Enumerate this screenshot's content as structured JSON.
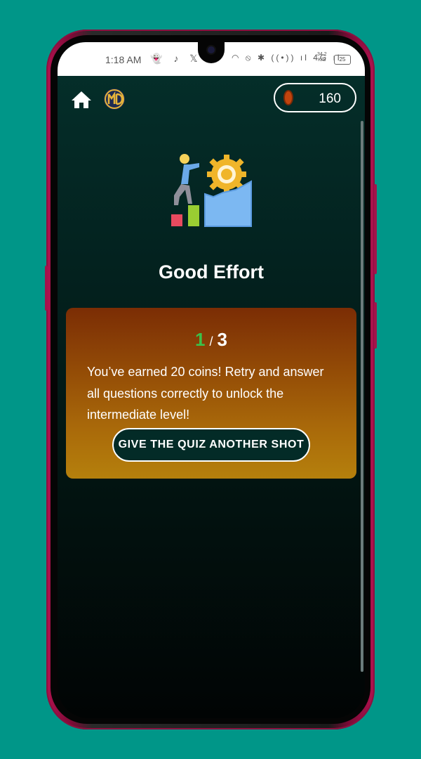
{
  "statusbar": {
    "time": "1:18 AM",
    "left_icons": "👻 ♪ 𝕏",
    "right_icons": "◠ ⦸ ✱ ((•)) ıl 4G ıl",
    "net_speed_value": "34.2",
    "net_speed_unit": "K/S",
    "battery": "25"
  },
  "header": {
    "coins": "160",
    "home_icon": "home-icon",
    "logo_icon": "quiz-logo-icon",
    "coin_icon": "coin-icon"
  },
  "result": {
    "title": "Good Effort",
    "score_correct": "1",
    "score_separator": "/",
    "score_total": "3",
    "message": "You’ve earned 20 coins! Retry and answer all questions correctly to unlock the intermediate level!",
    "retry_label": "GIVE THE QUIZ ANOTHER SHOT"
  },
  "colors": {
    "background": "#009688",
    "card_top": "#7b2d05",
    "card_bottom": "#b5800c",
    "score_correct": "#3bc14a",
    "button_bg": "#032b27"
  }
}
